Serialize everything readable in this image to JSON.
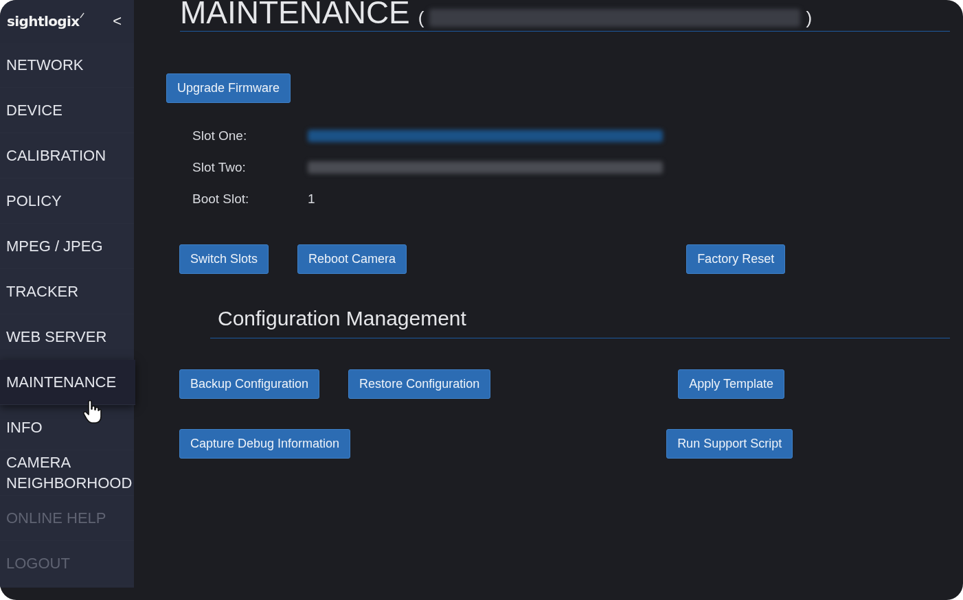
{
  "sidebar": {
    "logo": "sightlogix",
    "collapse": "<",
    "items": [
      {
        "label": "NETWORK",
        "selected": false,
        "disabled": false
      },
      {
        "label": "DEVICE",
        "selected": false,
        "disabled": false
      },
      {
        "label": "CALIBRATION",
        "selected": false,
        "disabled": false
      },
      {
        "label": "POLICY",
        "selected": false,
        "disabled": false
      },
      {
        "label": "MPEG / JPEG",
        "selected": false,
        "disabled": false
      },
      {
        "label": "TRACKER",
        "selected": false,
        "disabled": false
      },
      {
        "label": "WEB SERVER",
        "selected": false,
        "disabled": false
      },
      {
        "label": "MAINTENANCE",
        "selected": true,
        "disabled": false
      },
      {
        "label": "INFO",
        "selected": false,
        "disabled": false
      },
      {
        "label": "CAMERA NEIGHBORHOOD",
        "selected": false,
        "disabled": false
      },
      {
        "label": "ONLINE HELP",
        "selected": false,
        "disabled": true
      },
      {
        "label": "LOGOUT",
        "selected": false,
        "disabled": true
      }
    ]
  },
  "header": {
    "title": "MAINTENANCE",
    "open_paren": "(",
    "close_paren": ")",
    "redacted": true
  },
  "firmware": {
    "button": "Upgrade Firmware",
    "slots": [
      {
        "label": "Slot One:",
        "redacted": true,
        "link": true
      },
      {
        "label": "Slot Two:",
        "redacted": true,
        "link": false
      },
      {
        "label": "Boot Slot:",
        "value": "1",
        "redacted": false,
        "link": false
      }
    ],
    "buttons": [
      "Switch Slots",
      "Reboot Camera",
      "Factory Reset"
    ]
  },
  "configuration": {
    "heading": "Configuration Management",
    "button_rows": [
      [
        "Backup Configuration",
        "Restore Configuration",
        "Apply Template"
      ],
      [
        "Capture Debug Information",
        "Run Support Script"
      ]
    ]
  }
}
